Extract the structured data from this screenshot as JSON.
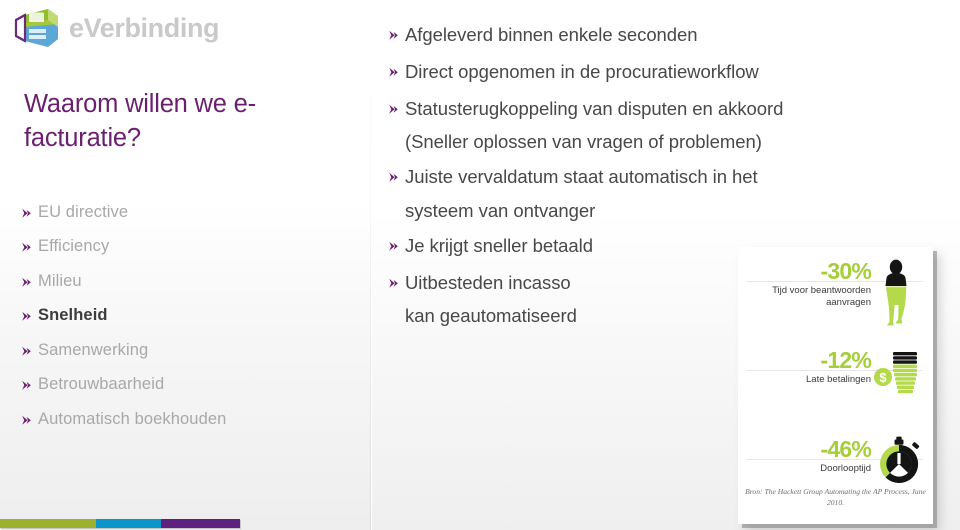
{
  "brand": {
    "name": "eVerbinding",
    "logo_icon": "cube-logo-icon",
    "colors": {
      "purple": "#6b1f6e",
      "green": "#a6ce39",
      "blue": "#0b95c9",
      "gray_text": "#a8a8a8"
    }
  },
  "title": "Waarom willen we e-facturatie?",
  "sidebar": {
    "items": [
      {
        "label": "EU directive",
        "active": false
      },
      {
        "label": "Efficiency",
        "active": false
      },
      {
        "label": "Milieu",
        "active": false
      },
      {
        "label": "Snelheid",
        "active": true
      },
      {
        "label": "Samenwerking",
        "active": false
      },
      {
        "label": "Betrouwbaarheid",
        "active": false
      },
      {
        "label": "Automatisch boekhouden",
        "active": false
      }
    ]
  },
  "main": {
    "bullets": [
      {
        "label": "Afgeleverd binnen enkele seconden",
        "continuation": false
      },
      {
        "label": "Direct opgenomen in de procuratieworkflow",
        "continuation": false
      },
      {
        "label": "Statusterugkoppeling van disputen en akkoord",
        "continuation": false
      },
      {
        "label": "(Sneller oplossen van vragen of problemen)",
        "continuation": true
      },
      {
        "label": "Juiste vervaldatum staat automatisch in het",
        "continuation": false
      },
      {
        "label": "systeem van ontvanger",
        "continuation": true
      },
      {
        "label": "Je krijgt sneller betaald",
        "continuation": false
      },
      {
        "label": "Uitbesteden incasso",
        "continuation": false
      },
      {
        "label": "kan geautomatiseerd",
        "continuation": true
      }
    ]
  },
  "infographic": {
    "rows": [
      {
        "pct": "-30%",
        "caption": "Tijd voor beantwoorden aanvragen",
        "icon": "person-icon"
      },
      {
        "pct": "-12%",
        "caption": "Late betalingen",
        "icon": "coin-stack-icon"
      },
      {
        "pct": "-46%",
        "caption": "Doorlooptijd",
        "icon": "stopwatch-icon"
      }
    ],
    "source": "Bron: The Hackett Group Automating the AP Process, June 2010."
  },
  "footer_bar": {
    "segments": [
      {
        "color": "#9cb22e"
      },
      {
        "color": "#0b95c9"
      },
      {
        "color": "#5e2180"
      }
    ]
  }
}
